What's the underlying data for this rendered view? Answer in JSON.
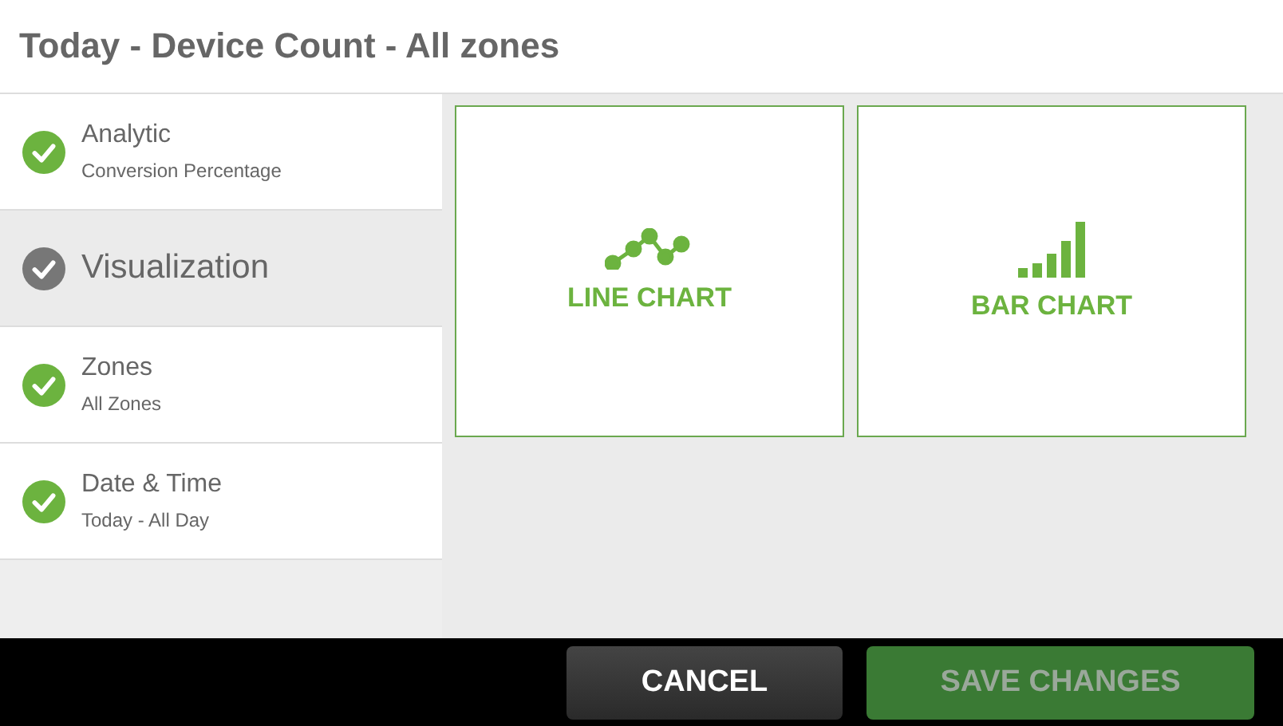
{
  "window": {
    "title": "Today - Device Count - All zones"
  },
  "steps": [
    {
      "title": "Analytic",
      "subtitle": "Conversion Percentage",
      "selected": false
    },
    {
      "title": "Visualization",
      "selected": true
    },
    {
      "title": "Zones",
      "subtitle": "All Zones",
      "selected": false
    },
    {
      "title": "Date & Time",
      "subtitle": "Today - All Day",
      "selected": false
    }
  ],
  "options": [
    {
      "kind": "line",
      "label": "LINE CHART"
    },
    {
      "kind": "bar",
      "label": "BAR CHART"
    }
  ],
  "buttons": [
    {
      "label": "CANCEL",
      "kind": "cancel",
      "disabled": false
    },
    {
      "label": "SAVE CHANGES",
      "kind": "save",
      "disabled": true
    }
  ]
}
